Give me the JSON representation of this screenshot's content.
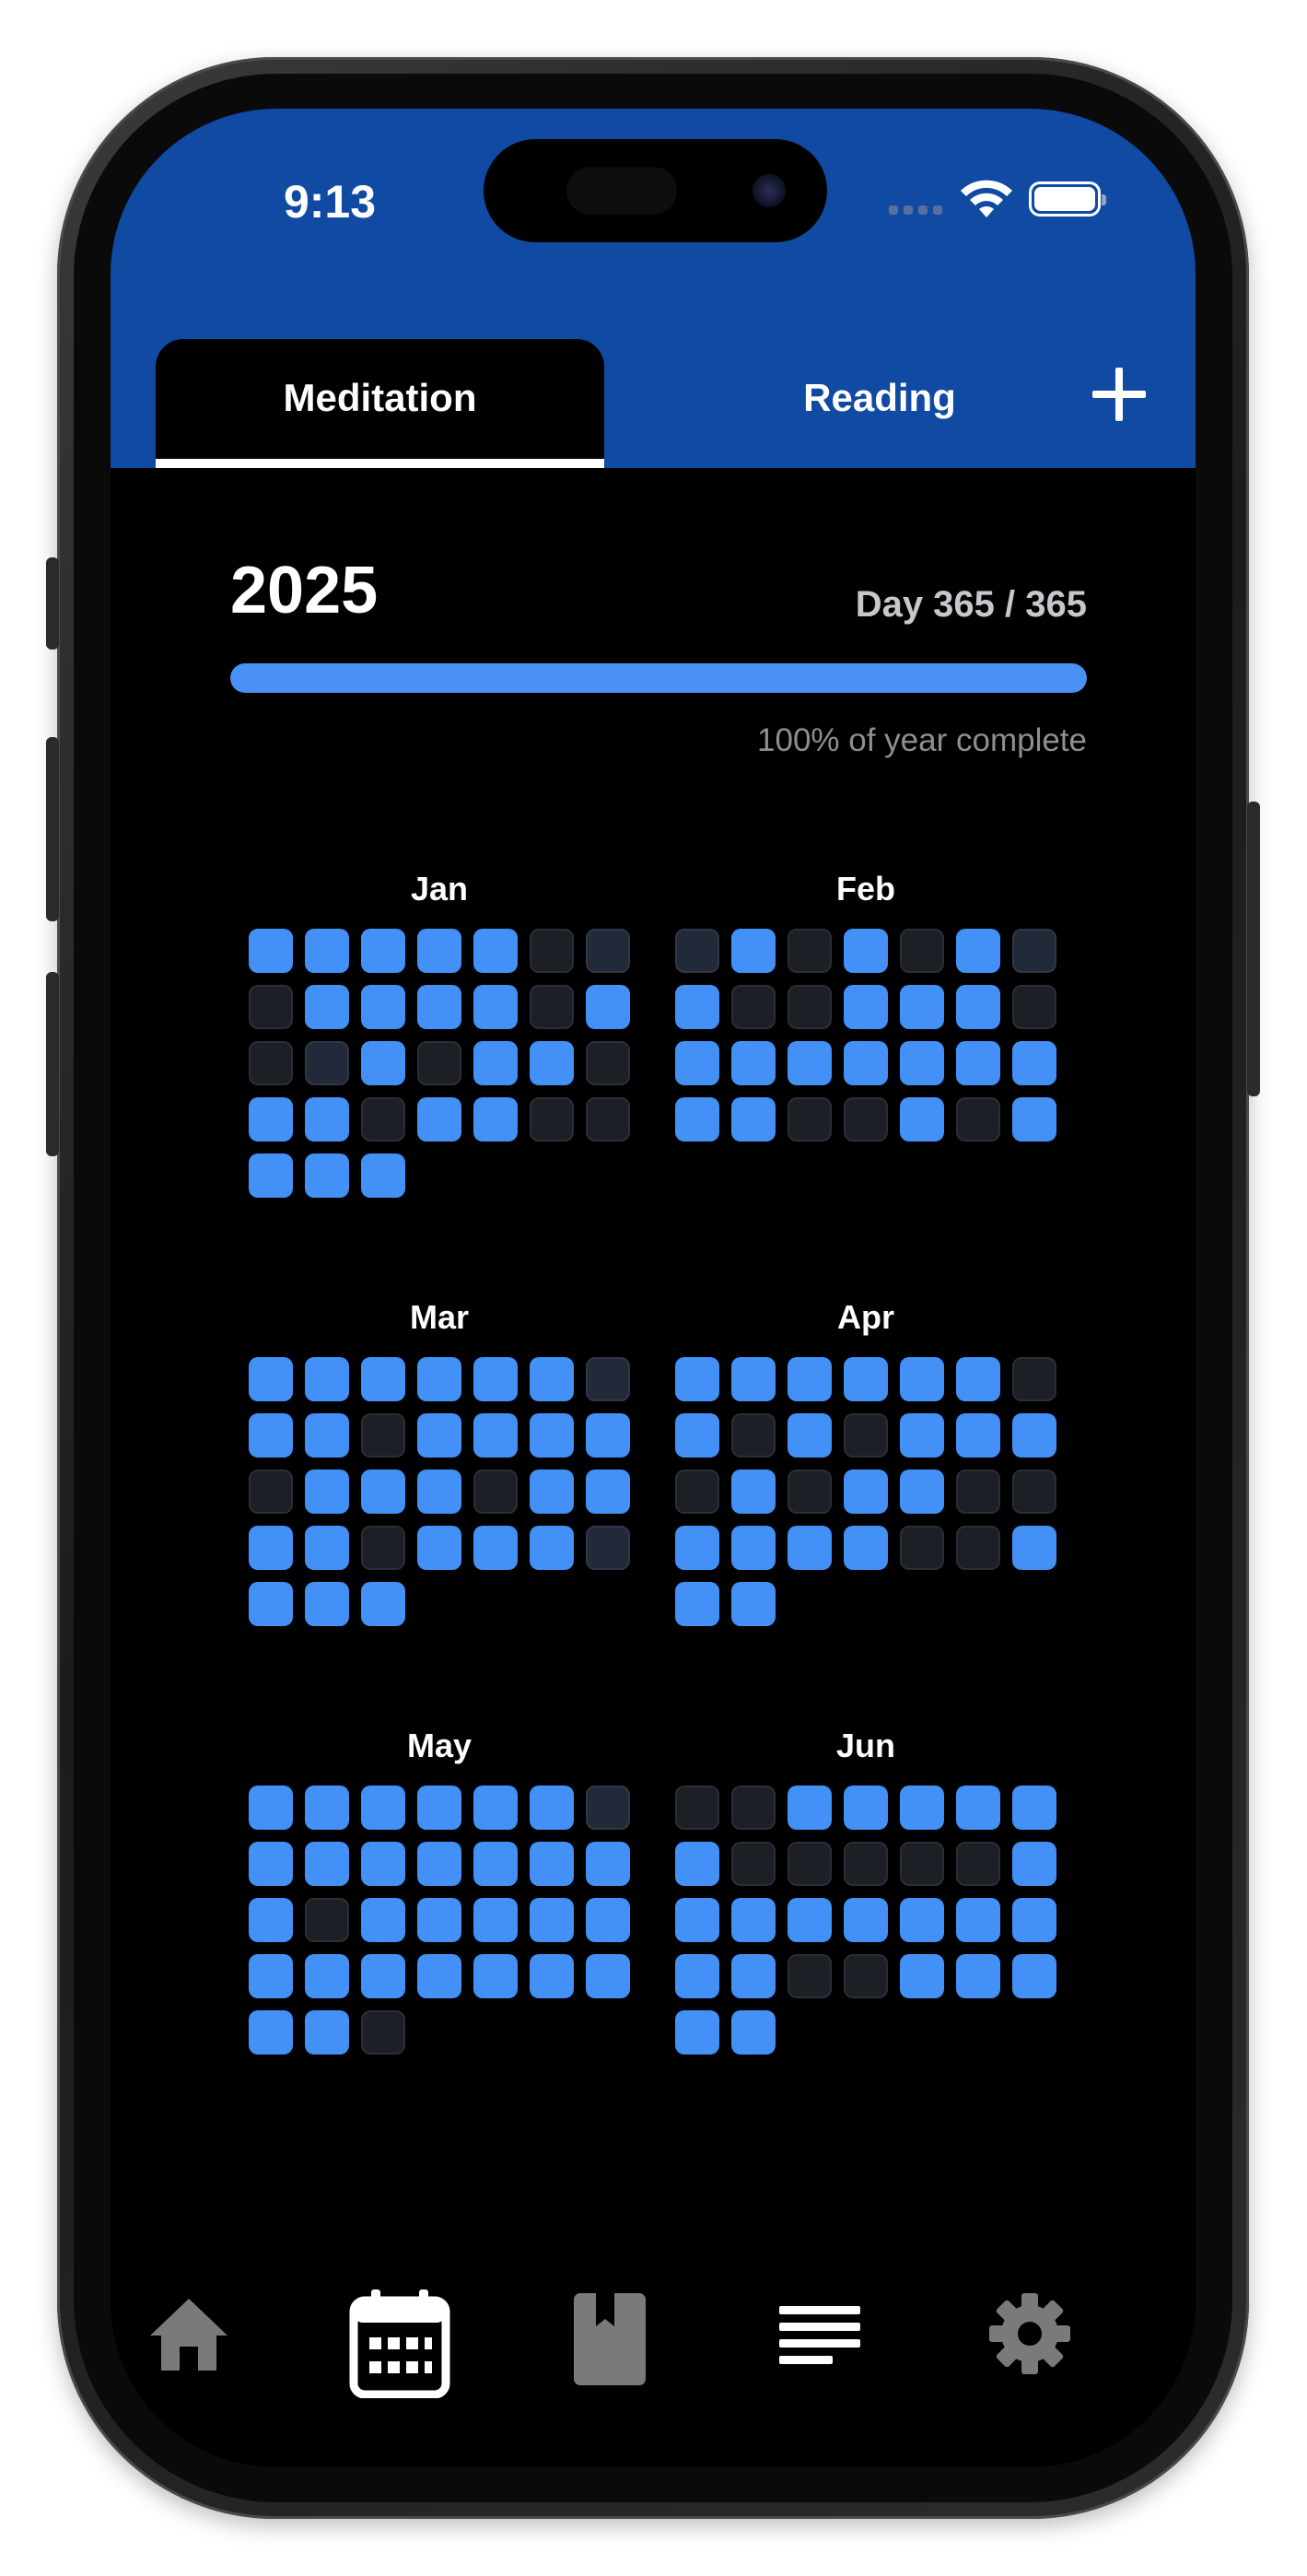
{
  "status_bar": {
    "time": "9:13"
  },
  "tabs": {
    "items": [
      {
        "label": "Meditation",
        "selected": true
      },
      {
        "label": "Reading",
        "selected": false
      }
    ],
    "add_icon": "plus-icon"
  },
  "year": {
    "title": "2025",
    "day_counter": "Day 365 / 365",
    "progress_percent": 100,
    "caption": "100% of year complete"
  },
  "colors": {
    "header_blue": "#114aa3",
    "accent_blue": "#4390f6",
    "day_empty": "#1c1f25"
  },
  "months": [
    {
      "label": "Jan",
      "days": [
        1,
        1,
        1,
        1,
        1,
        0,
        2,
        0,
        1,
        1,
        1,
        1,
        0,
        1,
        0,
        2,
        1,
        0,
        1,
        1,
        0,
        1,
        1,
        0,
        1,
        1,
        0,
        0,
        1,
        1,
        1
      ]
    },
    {
      "label": "Feb",
      "days": [
        2,
        1,
        0,
        1,
        0,
        1,
        2,
        1,
        0,
        0,
        1,
        1,
        1,
        0,
        1,
        1,
        1,
        1,
        1,
        1,
        1,
        1,
        1,
        0,
        0,
        1,
        0,
        1
      ]
    },
    {
      "label": "Mar",
      "days": [
        1,
        1,
        1,
        1,
        1,
        1,
        2,
        1,
        1,
        0,
        1,
        1,
        1,
        1,
        0,
        1,
        1,
        1,
        0,
        1,
        1,
        1,
        1,
        0,
        1,
        1,
        1,
        2,
        1,
        1,
        1
      ]
    },
    {
      "label": "Apr",
      "days": [
        1,
        1,
        1,
        1,
        1,
        1,
        0,
        1,
        0,
        1,
        0,
        1,
        1,
        1,
        0,
        1,
        0,
        1,
        1,
        0,
        0,
        1,
        1,
        1,
        1,
        0,
        0,
        1,
        1,
        1
      ]
    },
    {
      "label": "May",
      "days": [
        1,
        1,
        1,
        1,
        1,
        1,
        2,
        1,
        1,
        1,
        1,
        1,
        1,
        1,
        1,
        0,
        1,
        1,
        1,
        1,
        1,
        1,
        1,
        1,
        1,
        1,
        1,
        1,
        1,
        1,
        0
      ]
    },
    {
      "label": "Jun",
      "days": [
        0,
        0,
        1,
        1,
        1,
        1,
        1,
        1,
        0,
        0,
        0,
        0,
        0,
        1,
        1,
        1,
        1,
        1,
        1,
        1,
        1,
        1,
        1,
        0,
        0,
        1,
        1,
        1,
        1,
        1
      ]
    }
  ],
  "bottom_nav": [
    {
      "icon": "home-icon",
      "active": false
    },
    {
      "icon": "calendar-icon",
      "active": true
    },
    {
      "icon": "bookmark-book-icon",
      "active": false
    },
    {
      "icon": "list-lines-icon",
      "active": false
    },
    {
      "icon": "gear-icon",
      "active": false
    }
  ]
}
